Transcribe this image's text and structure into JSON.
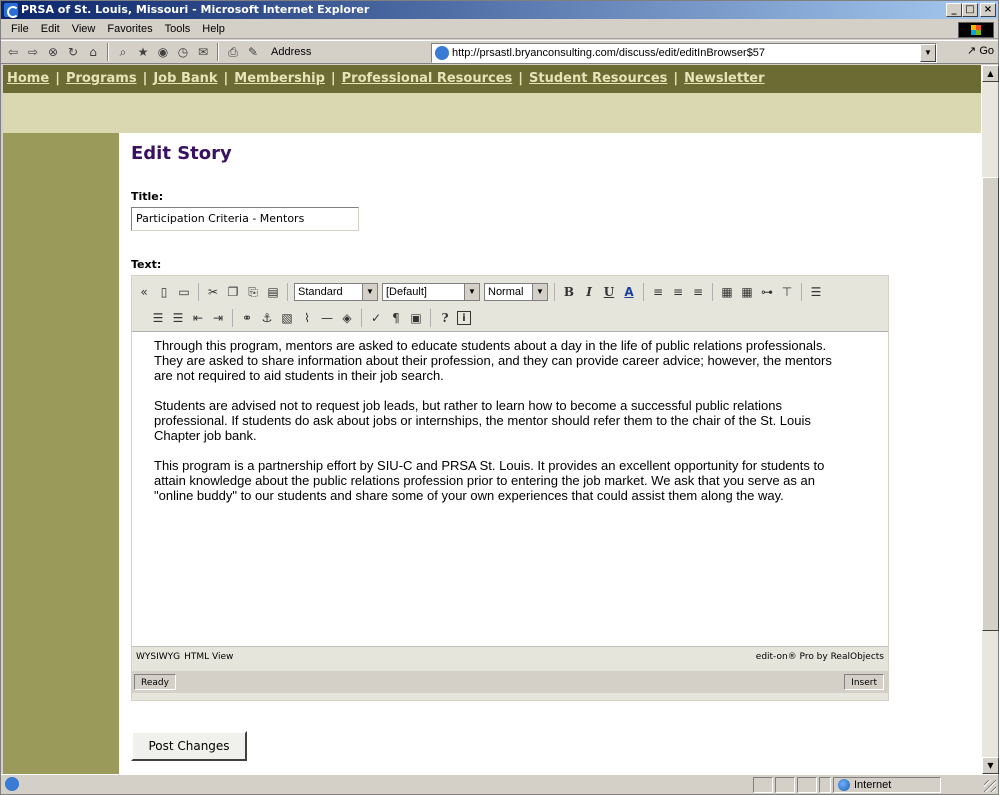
{
  "window": {
    "title": "PRSA of St. Louis, Missouri - Microsoft Internet Explorer",
    "minimize": "_",
    "maximize": "□",
    "close": "×"
  },
  "menubar": [
    {
      "label": "File"
    },
    {
      "label": "Edit"
    },
    {
      "label": "View"
    },
    {
      "label": "Favorites"
    },
    {
      "label": "Tools"
    },
    {
      "label": "Help"
    }
  ],
  "toolbar": {
    "address_label": "Address",
    "address_value": "http://prsastl.bryanconsulting.com/discuss/edit/editInBrowser$57",
    "go_label": "Go"
  },
  "sitenav": [
    {
      "label": "Home"
    },
    {
      "label": "Programs"
    },
    {
      "label": "Job Bank"
    },
    {
      "label": "Membership"
    },
    {
      "label": "Professional Resources"
    },
    {
      "label": "Student Resources"
    },
    {
      "label": "Newsletter"
    }
  ],
  "sitenav_sep": "|",
  "page": {
    "title": "Edit Story",
    "title_label": "Title:",
    "title_value": "Participation Criteria - Mentors",
    "text_label": "Text:",
    "post_button": "Post Changes"
  },
  "editor": {
    "style_select": "Standard",
    "font_select": "[Default]",
    "size_select": "Normal",
    "paragraphs": [
      "Through this program, mentors are asked to educate students about a day in the life of public relations professionals.  They are asked to share information about their profession, and they can provide career advice; however, the mentors are not required to aid students in their job search.",
      "Students are advised not to request job leads, but rather to learn how to become a successful public relations professional.  If students do ask about jobs or internships, the mentor should refer them to the chair of the St. Louis Chapter job bank.",
      "This program is a partnership effort by SIU-C and PRSA St. Louis. It provides an excellent opportunity for students to attain knowledge about the public relations profession prior to entering the job market.  We ask that you serve as an \"online buddy\" to our students and share some of your own experiences that could assist them along the way."
    ],
    "tab_wysiwyg": "WYSIWYG",
    "tab_html": "HTML View",
    "credit": "edit-on® Pro by RealObjects",
    "status_ready": "Ready",
    "status_insert": "Insert"
  },
  "statusbar": {
    "zone": "Internet"
  }
}
